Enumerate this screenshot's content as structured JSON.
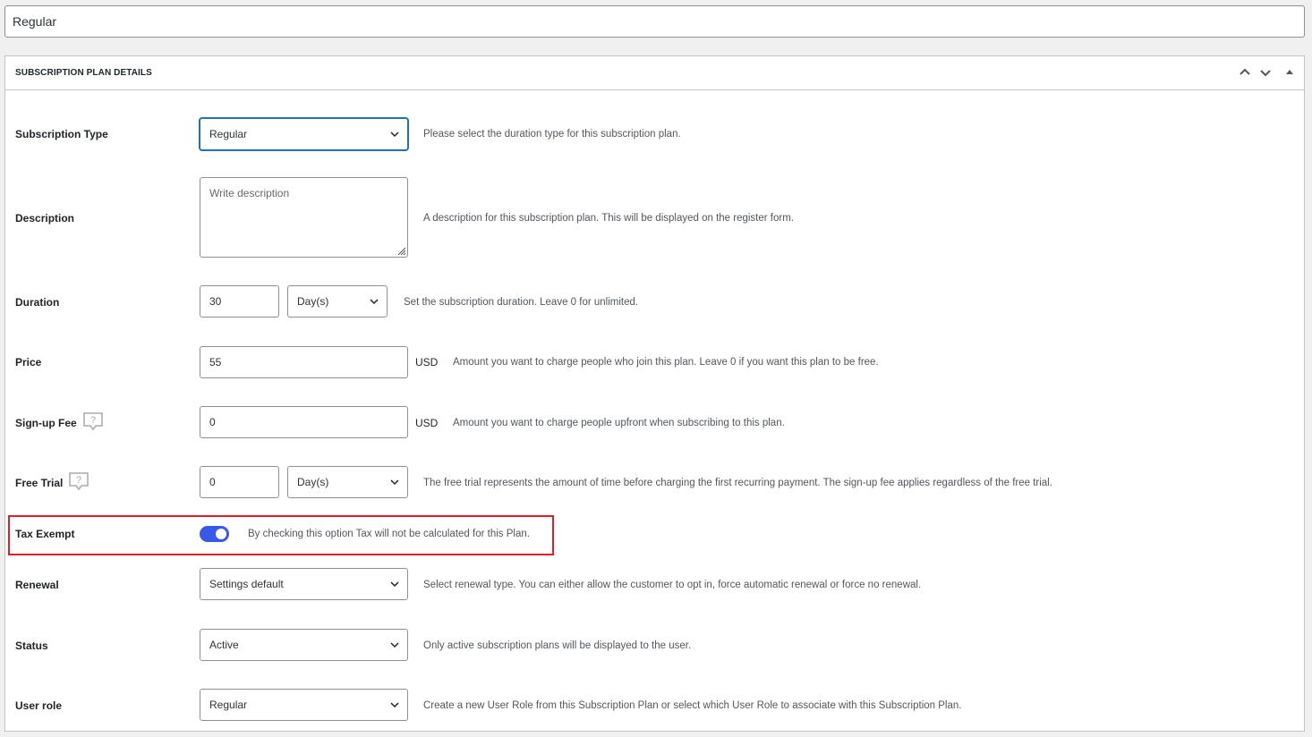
{
  "title_field": {
    "value": "Regular"
  },
  "box": {
    "title": "SUBSCRIPTION PLAN DETAILS",
    "controls": [
      "move-up",
      "move-down",
      "toggle-panel"
    ]
  },
  "fields": {
    "subscription_type": {
      "label": "Subscription Type",
      "value": "Regular",
      "description": "Please select the duration type for this subscription plan."
    },
    "description": {
      "label": "Description",
      "placeholder": "Write description",
      "description": "A description for this subscription plan. This will be displayed on the register form."
    },
    "duration": {
      "label": "Duration",
      "value": "30",
      "unit_value": "Day(s)",
      "description": "Set the subscription duration. Leave 0 for unlimited."
    },
    "price": {
      "label": "Price",
      "value": "55",
      "currency": "USD",
      "description": "Amount you want to charge people who join this plan. Leave 0 if you want this plan to be free."
    },
    "signup_fee": {
      "label": "Sign-up Fee",
      "value": "0",
      "currency": "USD",
      "description": "Amount you want to charge people upfront when subscribing to this plan."
    },
    "free_trial": {
      "label": "Free Trial",
      "value": "0",
      "unit_value": "Day(s)",
      "description": "The free trial represents the amount of time before charging the first recurring payment. The sign-up fee applies regardless of the free trial."
    },
    "tax_exempt": {
      "label": "Tax Exempt",
      "enabled": true,
      "description": "By checking this option Tax will not be calculated for this Plan."
    },
    "renewal": {
      "label": "Renewal",
      "value": "Settings default",
      "description": "Select renewal type. You can either allow the customer to opt in, force automatic renewal or force no renewal."
    },
    "status": {
      "label": "Status",
      "value": "Active",
      "description": "Only active subscription plans will be displayed to the user."
    },
    "user_role": {
      "label": "User role",
      "value": "Regular",
      "description": "Create a new User Role from this Subscription Plan or select which User Role to associate with this Subscription Plan."
    }
  },
  "colors": {
    "toggle_on": "#3858e9",
    "highlight_border": "#e01e26",
    "focus_border": "#2271b1"
  }
}
